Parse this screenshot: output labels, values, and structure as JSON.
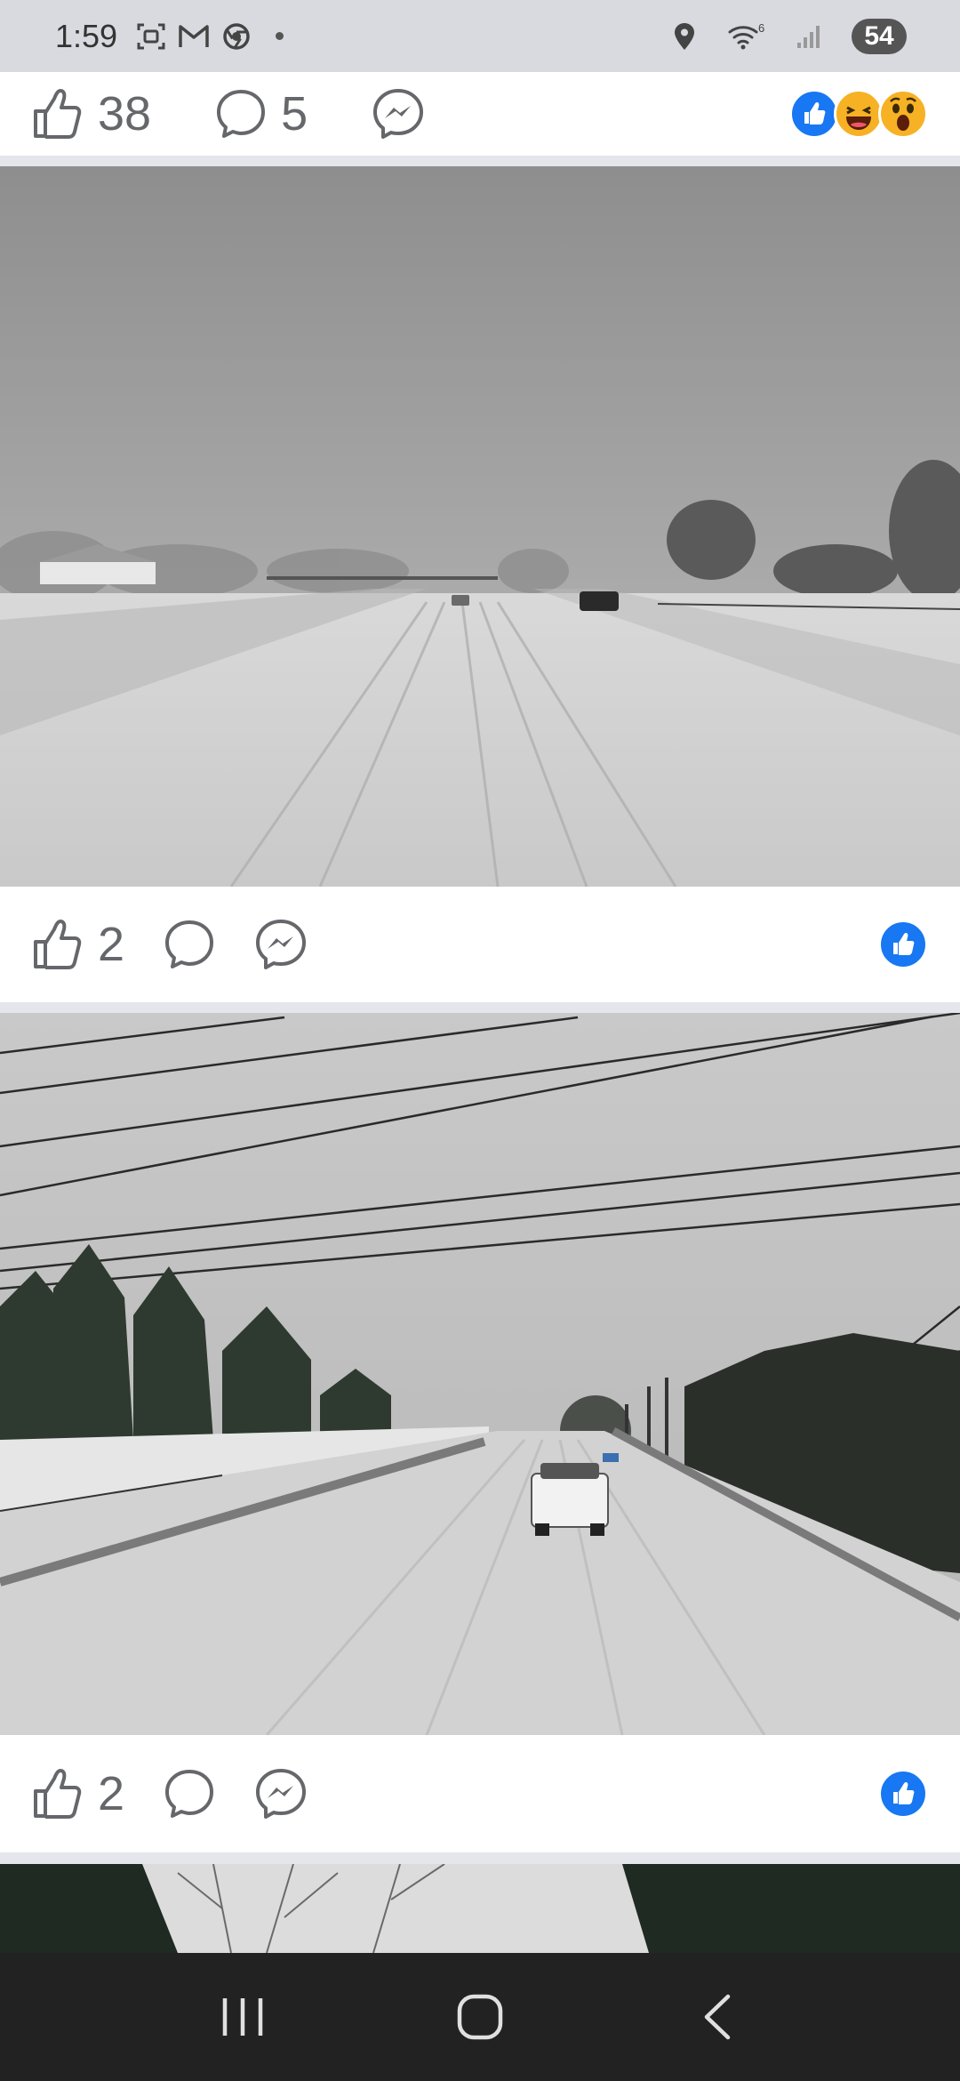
{
  "status_bar": {
    "time": "1:59",
    "left_icons": [
      "screenshot-icon",
      "gmail-icon",
      "chrome-icon",
      "dot-icon"
    ],
    "right_icons": [
      "location-icon",
      "wifi-6-icon",
      "signal-icon"
    ],
    "wifi_label": "6",
    "battery": "54"
  },
  "posts": [
    {
      "like_count": "38",
      "comment_count": "5",
      "reactions": [
        "like-reaction-icon",
        "haha-reaction-icon",
        "wow-reaction-icon"
      ]
    },
    {
      "photo": "snowy-highway-photo",
      "like_count": "2",
      "comment_count": "",
      "reactions": [
        "like-reaction-icon"
      ]
    },
    {
      "photo": "snowy-highway-truck-photo",
      "like_count": "2",
      "comment_count": "",
      "reactions": [
        "like-reaction-icon"
      ]
    },
    {
      "photo": "snowy-trees-photo"
    }
  ],
  "nav_bar": {
    "buttons": [
      "recent-apps-icon",
      "home-icon",
      "back-icon"
    ]
  },
  "colors": {
    "facebook_blue": "#1877f2",
    "icon_gray": "#65676b",
    "divider": "#e4e6eb"
  }
}
